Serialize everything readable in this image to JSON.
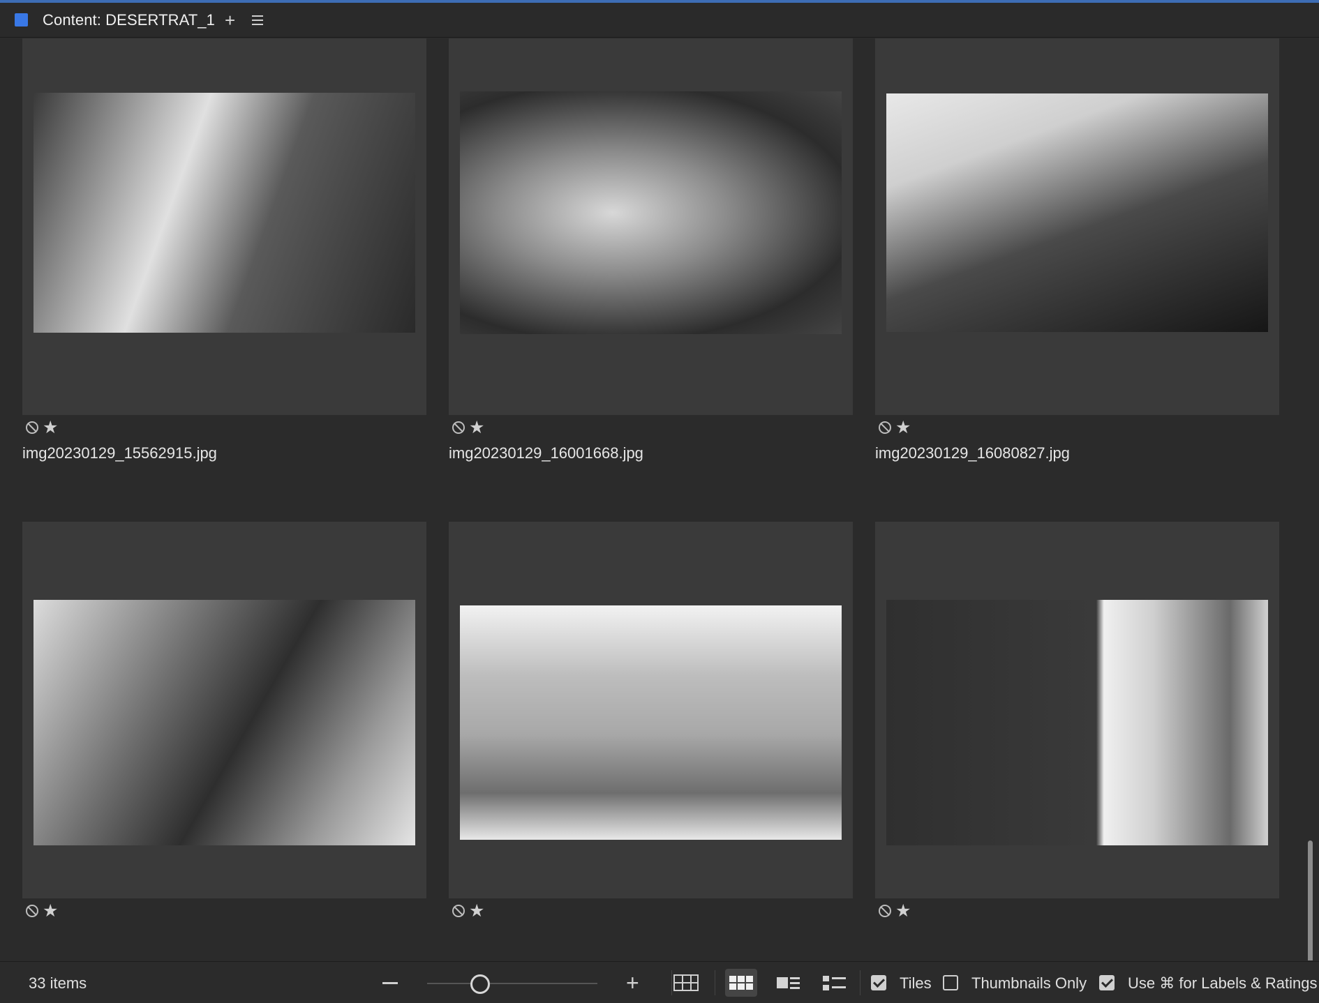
{
  "panel": {
    "title": "Content: DESERTRAT_1",
    "add_symbol": "+"
  },
  "tiles": [
    {
      "filename": "img20230129_15562915.jpg",
      "star": "★"
    },
    {
      "filename": "img20230129_16001668.jpg",
      "star": "★"
    },
    {
      "filename": "img20230129_16080827.jpg",
      "star": "★"
    },
    {
      "filename": "",
      "star": "★"
    },
    {
      "filename": "",
      "star": "★"
    },
    {
      "filename": "",
      "star": "★"
    }
  ],
  "footer": {
    "item_count": "33 items",
    "zoom_plus": "+",
    "tiles_label": "Tiles",
    "tiles_checked": true,
    "thumbnails_only_label": "Thumbnails Only",
    "thumbnails_only_checked": false,
    "labels_label": "Use ⌘ for Labels & Ratings",
    "labels_checked": true
  },
  "colors": {
    "background": "#2b2b2b",
    "tile": "#3a3a3a",
    "accent": "#3978e6"
  }
}
